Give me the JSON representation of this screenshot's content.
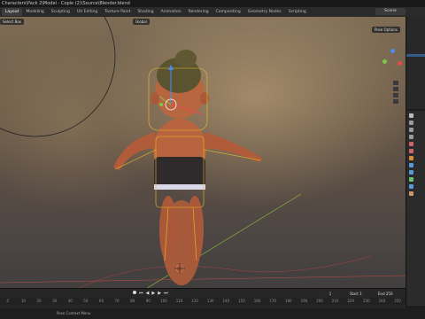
{
  "window": {
    "title": "Characters\\Pack 2\\Model - Copie (2)\\Source\\Blender.blend"
  },
  "workspaces": [
    "Layout",
    "Modeling",
    "Sculpting",
    "UV Editing",
    "Texture Paint",
    "Shading",
    "Animation",
    "Rendering",
    "Compositing",
    "Geometry Nodes",
    "Scripting"
  ],
  "active_workspace": "Layout",
  "scene": {
    "label": "Scene"
  },
  "viewport": {
    "select_mode": "Select Box",
    "transform_orientation": "Global",
    "pose_options": "Pose Options"
  },
  "timeline": {
    "start_label": "Start",
    "start_value": "1",
    "end_label": "End",
    "end_value": "250",
    "current_frame": "1",
    "frame_ticks": [
      "0",
      "10",
      "20",
      "30",
      "40",
      "50",
      "60",
      "70",
      "80",
      "90",
      "100",
      "110",
      "120",
      "130",
      "140",
      "150",
      "160",
      "170",
      "180",
      "190",
      "200",
      "210",
      "220",
      "230",
      "240",
      "250"
    ]
  },
  "status": {
    "text": "Pose Context Menu"
  },
  "colors": {
    "accent": "#f0c020",
    "x_axis": "#e74a4a",
    "y_axis": "#7ec64a",
    "z_axis": "#4a8cf0"
  }
}
